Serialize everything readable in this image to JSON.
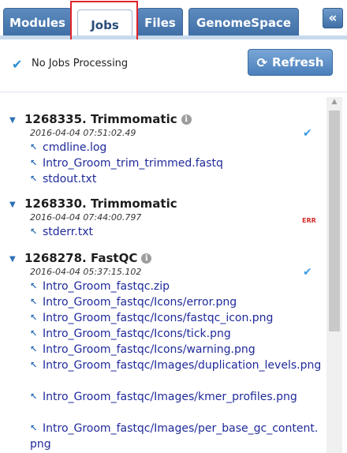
{
  "tabs": [
    {
      "label": "Modules",
      "active": false
    },
    {
      "label": "Jobs",
      "active": true
    },
    {
      "label": "Files",
      "active": false
    },
    {
      "label": "GenomeSpace",
      "active": false
    }
  ],
  "collapse_icon": "double-chevron-left-icon",
  "status": {
    "icon": "checkmark-icon",
    "text": "No Jobs Processing"
  },
  "refresh": {
    "icon": "refresh-icon",
    "label": "Refresh"
  },
  "jobs": [
    {
      "title": "1268335. Trimmomatic",
      "date": "2016-04-04 07:51:02.49",
      "status": "ok",
      "files": [
        "cmdline.log",
        "Intro_Groom_trim_trimmed.fastq",
        "stdout.txt"
      ]
    },
    {
      "title": "1268330. Trimmomatic",
      "date": "2016-04-04 07:44:00.797",
      "status": "error",
      "status_label": "ERR",
      "files": [
        "stderr.txt"
      ]
    },
    {
      "title": "1268278. FastQC",
      "date": "2016-04-04 05:37:15.102",
      "status": "ok",
      "files": [
        "Intro_Groom_fastqc.zip",
        "Intro_Groom_fastqc/Icons/error.png",
        "Intro_Groom_fastqc/Icons/fastqc_icon.png",
        "Intro_Groom_fastqc/Icons/tick.png",
        "Intro_Groom_fastqc/Icons/warning.png",
        "Intro_Groom_fastqc/Images/duplication_levels.png",
        "Intro_Groom_fastqc/Images/kmer_profiles.png",
        "Intro_Groom_fastqc/Images/per_base_gc_content.png"
      ]
    }
  ],
  "colors": {
    "tab_blue": "#3f6fa6",
    "link": "#1f2a9a",
    "ok_check": "#3a9be0",
    "error": "#d42c2c",
    "highlight": "#e2232a"
  }
}
